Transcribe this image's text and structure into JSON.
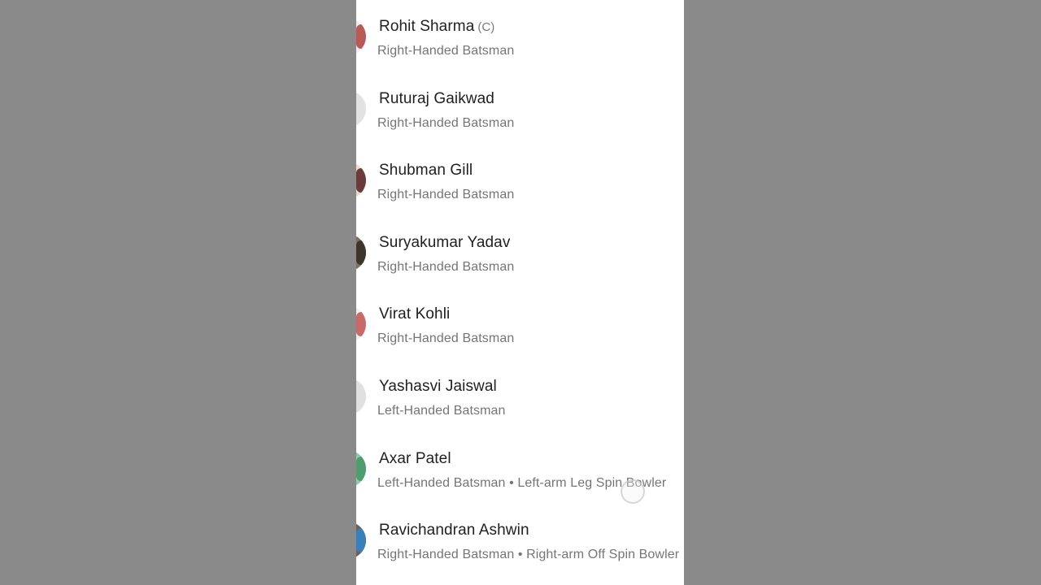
{
  "players": [
    {
      "name": "Rohit Sharma",
      "badge": "(C)",
      "role": "Right-Handed Batsman",
      "avatar_bg": "#eeeeee",
      "avatar_accent": "#b85a5a"
    },
    {
      "name": "Ruturaj Gaikwad",
      "badge": "",
      "role": "Right-Handed Batsman",
      "avatar_bg": "#e2e2e2",
      "avatar_accent": "#e2e2e2"
    },
    {
      "name": "Shubman Gill",
      "badge": "",
      "role": "Right-Handed Batsman",
      "avatar_bg": "#f1d9cc",
      "avatar_accent": "#6a3b3b"
    },
    {
      "name": "Suryakumar Yadav",
      "badge": "",
      "role": "Right-Handed Batsman",
      "avatar_bg": "#7a7066",
      "avatar_accent": "#3d342c"
    },
    {
      "name": "Virat Kohli",
      "badge": "",
      "role": "Right-Handed Batsman",
      "avatar_bg": "#efefef",
      "avatar_accent": "#c96a6a"
    },
    {
      "name": "Yashasvi Jaiswal",
      "badge": "",
      "role": "Left-Handed Batsman",
      "avatar_bg": "#e0e0e0",
      "avatar_accent": "#e0e0e0"
    },
    {
      "name": "Axar Patel",
      "badge": "",
      "role": "Left-Handed Batsman • Left-arm Leg Spin Bowler",
      "avatar_bg": "#8fc9a8",
      "avatar_accent": "#4f9c6e"
    },
    {
      "name": "Ravichandran Ashwin",
      "badge": "",
      "role": "Right-Handed Batsman • Right-arm Off Spin Bowler",
      "avatar_bg": "#6e6258",
      "avatar_accent": "#3a7fb8"
    }
  ]
}
